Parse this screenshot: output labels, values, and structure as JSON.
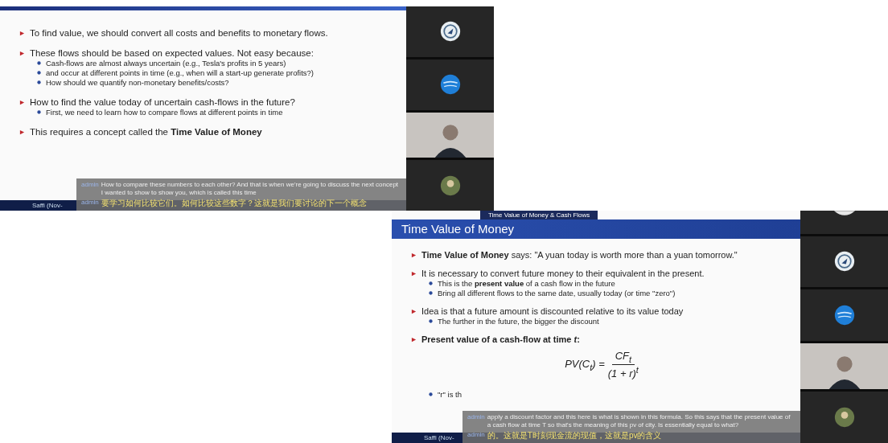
{
  "panels": [
    {
      "bullets": [
        {
          "text": "To find value, we should convert all costs and benefits to monetary flows."
        },
        {
          "text": "These flows should be based on expected values. Not easy because:",
          "children": [
            "Cash-flows are almost always uncertain (e.g., Tesla's profits in 5 years)",
            "and occur at different points in time (e.g., when will a start-up generate profits?)",
            "How should we quantify non-monetary benefits/costs?"
          ]
        },
        {
          "text": "How to find the value today of uncertain cash-flows in the future?",
          "children": [
            "First, we need to learn how to compare flows at different points in time"
          ]
        },
        {
          "text": "This requires a concept called the **Time Value of Money**"
        }
      ],
      "footer": "Saffi (Nov-",
      "subtitles": [
        {
          "speaker": "admin",
          "kind": "original",
          "text": "How to compare these numbers to each other? And that is when we're going to discuss the next concept I wanted to show to show you, which is called this time"
        },
        {
          "speaker": "admin",
          "kind": "translation",
          "text": "要学习如何比较它们。如何比较这些数字？这就是我们要讨论的下一个概念"
        }
      ],
      "participants": [
        {
          "kind": "logo"
        },
        {
          "kind": "globe"
        },
        {
          "kind": "video"
        },
        {
          "kind": "avatar"
        }
      ]
    },
    {
      "section": "Time Value of Money & Cash Flows",
      "title": "Time Value of Money",
      "bullets": [
        {
          "text": "**Time Value of Money** says: \"A yuan today is worth more than a yuan tomorrow.\""
        },
        {
          "text": "It is necessary to convert future money to their equivalent in the present.",
          "children": [
            "This is the **present value** of a cash flow in the future",
            "Bring all different flows to the same date, usually today (or time \"zero\")"
          ]
        },
        {
          "text": "Idea is that a future amount is discounted relative to its value today",
          "children": [
            "The further in the future, the bigger the discount"
          ]
        },
        {
          "text": "Present value of a cash-flow at time *t*:",
          "bold": true
        }
      ],
      "formula": {
        "lhs": "PV(C$_{t}$) =",
        "numerator": "CF$_{t}$",
        "denominator": "(1 + r)$^{t}$"
      },
      "trailing": "\"r\" is th",
      "footer": "Saffi (Nov-",
      "subtitles": [
        {
          "speaker": "admin",
          "kind": "original",
          "text": "apply a discount factor and this here is what is shown in this formula. So this says that the present value of a cash flow at time T so that's the meaning of this pv of city. Is essentially equal to what?"
        },
        {
          "speaker": "admin",
          "kind": "translation",
          "text": "的。这就是T时刻现金流的现值，这就是pv的含义"
        }
      ],
      "participants": [
        {
          "kind": "cut"
        },
        {
          "kind": "logo"
        },
        {
          "kind": "globe"
        },
        {
          "kind": "video"
        },
        {
          "kind": "avatar"
        }
      ]
    }
  ]
}
